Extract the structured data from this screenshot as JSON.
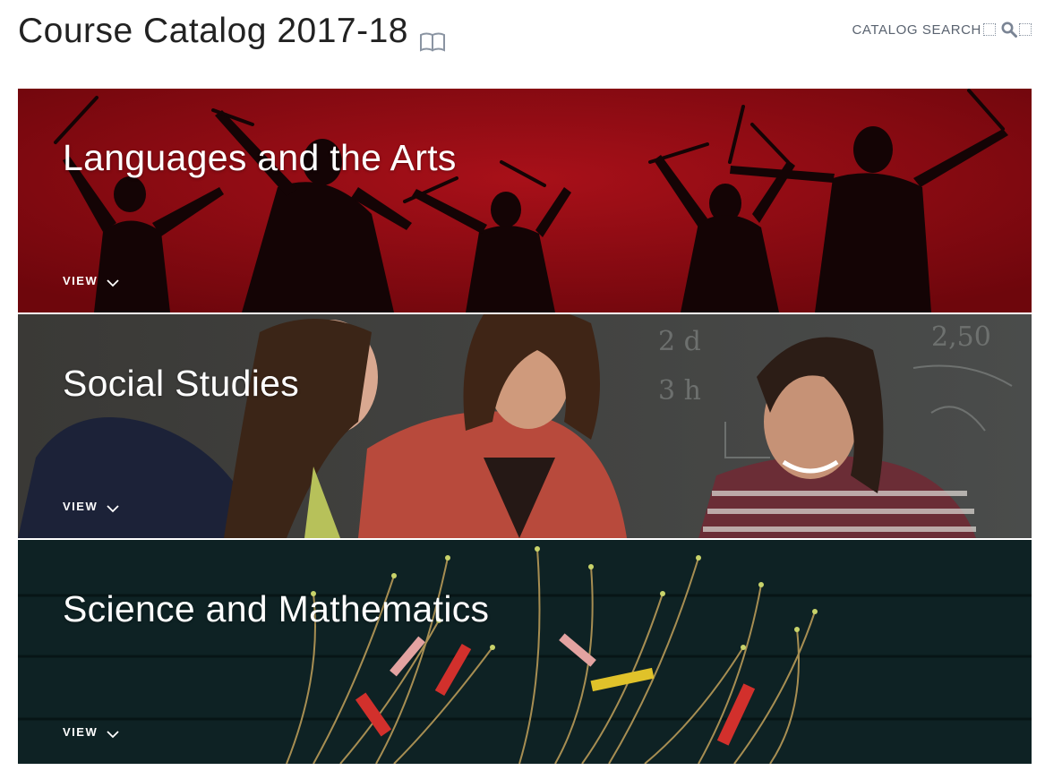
{
  "header": {
    "title": "Course Catalog 2017-18",
    "book_icon": "book-icon",
    "search_label": "CATALOG SEARCH",
    "search_icon": "search-icon"
  },
  "panels": [
    {
      "title": "Languages and the Arts",
      "view_label": "VIEW",
      "chevron_icon": "chevron-down-icon",
      "background_color": "#8c0a12"
    },
    {
      "title": "Social Studies",
      "view_label": "VIEW",
      "chevron_icon": "chevron-down-icon",
      "background_color": "#2f2e2c"
    },
    {
      "title": "Science and Mathematics",
      "view_label": "VIEW",
      "chevron_icon": "chevron-down-icon",
      "background_color": "#0e2224"
    }
  ]
}
